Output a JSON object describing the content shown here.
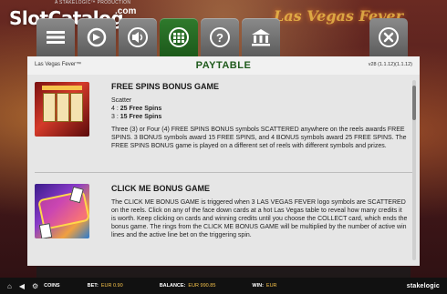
{
  "watermark": {
    "logo": "SlotCatalog",
    "com": ".com"
  },
  "provider_tag": "A STAKELOGIC™ PRODUCTION",
  "background_sign": "Las Vegas Fever",
  "tabs": [
    {
      "name": "menu",
      "icon": "menu-icon"
    },
    {
      "name": "autoplay",
      "icon": "autoplay-icon"
    },
    {
      "name": "sound",
      "icon": "sound-icon"
    },
    {
      "name": "paytable",
      "icon": "paytable-icon",
      "active": true
    },
    {
      "name": "help",
      "icon": "help-icon"
    },
    {
      "name": "rules",
      "icon": "bank-icon"
    }
  ],
  "close": {
    "icon": "close-icon"
  },
  "header": {
    "game_name": "Las Vegas Fever™",
    "title": "PAYTABLE",
    "version": "v28 (1.1.12)(1.1.12)"
  },
  "sections": [
    {
      "heading": "FREE SPINS BONUS GAME",
      "symbol_label": "Scatter",
      "awards": [
        {
          "count": "4 :",
          "value": "25 Free Spins"
        },
        {
          "count": "3 :",
          "value": "15 Free Spins"
        }
      ],
      "text": "Three (3) or Four (4) FREE SPINS BONUS symbols SCATTERED anywhere on the reels awards FREE SPINS. 3 BONUS symbols award 15 FREE SPINS, and 4 BONUS symbols award 25 FREE SPINS. The FREE SPINS BONUS game is played on a different set of reels with different symbols and prizes."
    },
    {
      "heading": "CLICK ME BONUS GAME",
      "text": "The CLICK ME BONUS GAME is triggered when 3 LAS VEGAS FEVER logo symbols are SCATTERED on the reels. Click on any of the face down cards at a hot Las Vegas table to reveal how many credits it is worth. Keep clicking on cards and winning credits until you choose the COLLECT card, which ends the bonus game. The rings from the CLICK ME BONUS GAME will be multiplied by the number of active win lines and the active line bet on the triggering spin."
    }
  ],
  "bottom_bar": {
    "coins_label": "COINS",
    "bet_label": "BET:",
    "bet_value": "EUR 0.90",
    "balance_label": "BALANCE:",
    "balance_value": "EUR 990.85",
    "win_label": "WIN:",
    "win_value": "EUR",
    "brand": "stakelogic"
  },
  "colors": {
    "paytable_title": "#1f5a1c",
    "active_tab": "#2f7a2c",
    "inactive_tab": "#7a7a7a",
    "panel_bg": "#e6e6e6"
  }
}
